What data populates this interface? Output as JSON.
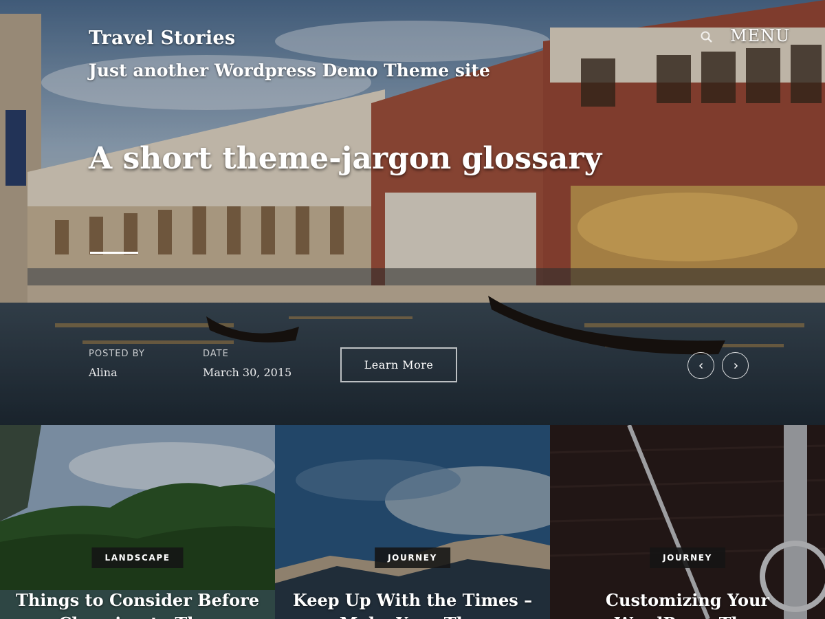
{
  "header": {
    "site_title": "Travel Stories",
    "site_description": "Just another Wordpress Demo Theme site",
    "menu_label": "MENU",
    "search_icon": "search-icon"
  },
  "hero": {
    "post_title": "A short theme-jargon glossary",
    "posted_by_label": "POSTED BY",
    "author": "Alina",
    "date_label": "DATE",
    "date": "March 30, 2015",
    "cta_label": "Learn More",
    "prev_icon": "chevron-left-icon",
    "next_icon": "chevron-right-icon"
  },
  "cards": [
    {
      "category": "LANDSCAPE",
      "title": "Things to Consider Before Choosing to Th..."
    },
    {
      "category": "JOURNEY",
      "title": "Keep Up With the Times – Make Your Th..."
    },
    {
      "category": "JOURNEY",
      "title": "Customizing Your WordPress Th..."
    }
  ],
  "colors": {
    "text": "#ffffff",
    "badge_bg": "#141414",
    "overlay": "#000000"
  }
}
